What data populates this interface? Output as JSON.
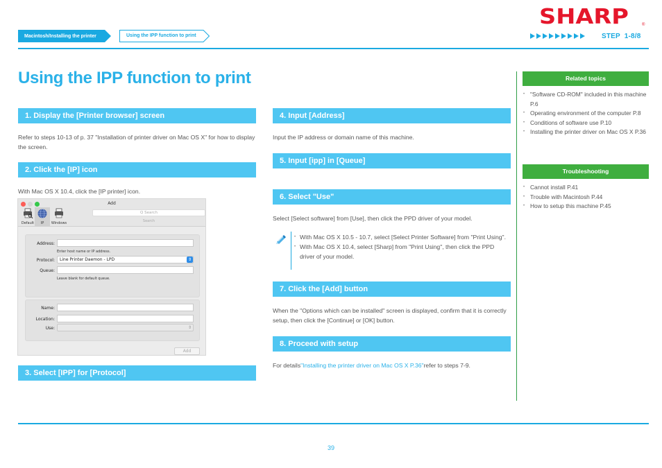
{
  "breadcrumb": {
    "parent": "Macintosh/Installing the printer",
    "current": "Using the IPP function to print"
  },
  "brand": {
    "logo_text": "SHARP",
    "registered_mark": "®",
    "color": "#e5162b"
  },
  "progress": {
    "arrow_count": 9,
    "step_label": "STEP  1-8/8"
  },
  "colors": {
    "accent_blue": "#1aa9e1",
    "step_header_blue": "#4fc6f2",
    "sidebar_green": "#3fae3f",
    "link_blue": "#2ab1e8"
  },
  "title": "Using the IPP function to print",
  "steps": [
    {
      "heading": "1.  Display the [Printer browser] screen",
      "text": "Refer to steps 10-13 of p. 37 \"Installation of printer driver on Mac OS X\" for how to display the screen."
    },
    {
      "heading": "2.  Click the [IP] icon",
      "text": "With Mac OS X 10.4, click the [IP printer] icon."
    },
    {
      "heading": "3.  Select [IPP] for [Protocol]",
      "text": ""
    },
    {
      "heading": "4.  Input [Address]",
      "text": "Input the IP address or domain name of this machine."
    },
    {
      "heading": "5.  Input [ipp] in [Queue]",
      "text": ""
    },
    {
      "heading": "6.  Select \"Use\"",
      "text": "Select [Select software] from [Use], then click the PPD driver of your model."
    },
    {
      "heading": "7.  Click the [Add] button",
      "text": "When the \"Options which can be installed\" screen is displayed, confirm that it is correctly setup, then click the [Continue] or [OK] button."
    },
    {
      "heading": "8.  Proceed with setup",
      "text_prefix": "For details",
      "link": "\"Installing the printer driver on Mac OS X P.36\"",
      "text_suffix": "refer to steps 7-9."
    }
  ],
  "note": {
    "icon": "pencil-note-icon",
    "items": [
      "With Mac OS X 10.5 - 10.7, select [Select Printer Software] from \"Print Using\".",
      "With Mac OS X 10.4, select [Sharp] from \"Print Using\", then click the PPD driver of your model."
    ]
  },
  "dialog": {
    "title": "Add",
    "toolbar": [
      {
        "label": "Default",
        "icon": "printer-search-icon"
      },
      {
        "label": "IP",
        "icon": "globe-icon",
        "selected": true
      },
      {
        "label": "Windows",
        "icon": "printer-icon"
      }
    ],
    "search_placeholder": "Q Search",
    "search_caption": "Search",
    "fields": {
      "address_label": "Address:",
      "address_value": "",
      "address_hint": "Enter host name or IP address.",
      "protocol_label": "Protocol:",
      "protocol_value": "Line Printer Daemon - LPD",
      "queue_label": "Queue:",
      "queue_value": "",
      "queue_hint": "Leave blank for default queue.",
      "name_label": "Name:",
      "name_value": "",
      "location_label": "Location:",
      "location_value": "",
      "use_label": "Use:",
      "use_value": ""
    },
    "add_button": "Add",
    "select_arrow": "⇕"
  },
  "sidebar": {
    "related": {
      "heading": "Related topics",
      "items": [
        "\"Software CD-ROM\" included in this machine P.6",
        "Operating environment of the computer P.8",
        "Conditions of software use P.10",
        "Installing the printer driver on Mac OS X P.36"
      ]
    },
    "troubleshooting": {
      "heading": "Troubleshooting",
      "items": [
        "Cannot install P.41",
        "Trouble with Macintosh P.44",
        "How to setup this machine P.45"
      ]
    }
  },
  "page_number": "39"
}
